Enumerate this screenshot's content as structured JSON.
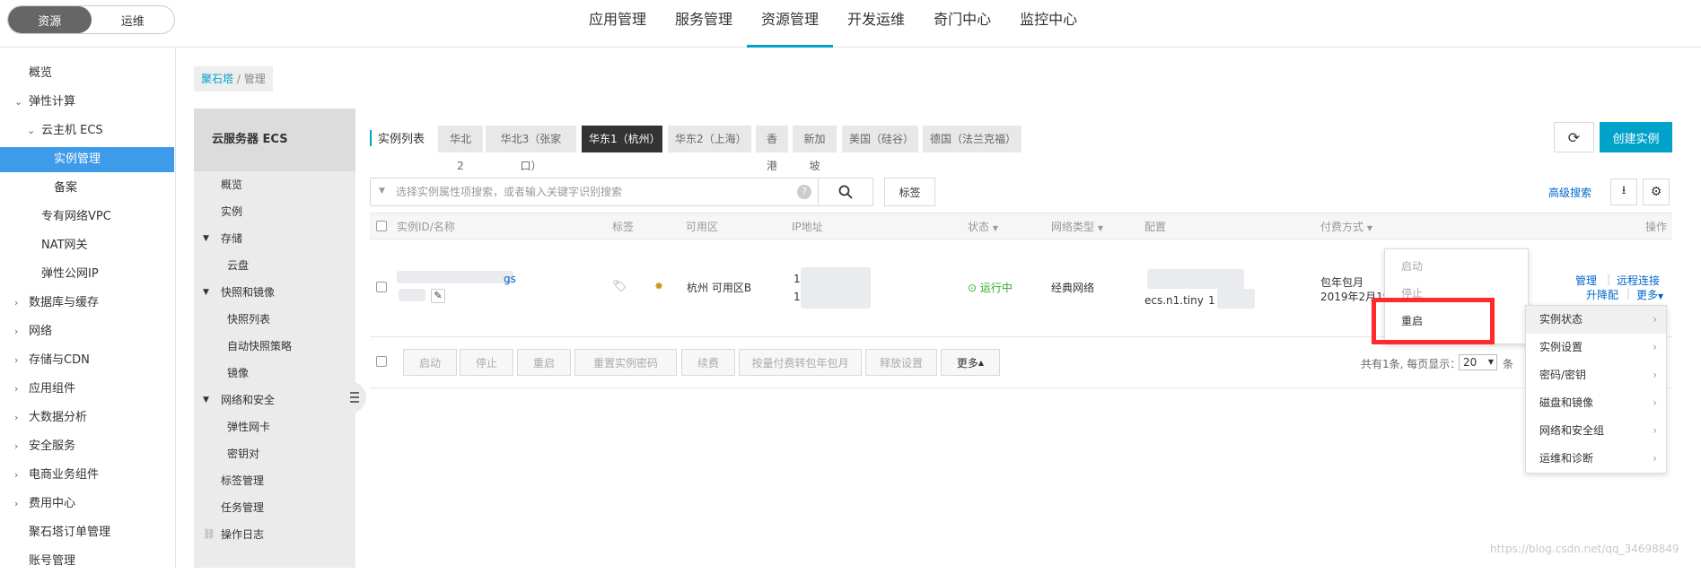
{
  "topbar": {
    "segments": [
      "资源",
      "运维"
    ],
    "nav": [
      "应用管理",
      "服务管理",
      "资源管理",
      "开发运维",
      "奇门中心",
      "监控中心"
    ]
  },
  "sidebar": {
    "items": [
      {
        "label": "概览"
      },
      {
        "label": "弹性计算",
        "chevron": "v"
      },
      {
        "label": "云主机 ECS",
        "chevron": "v"
      },
      {
        "label": "实例管理"
      },
      {
        "label": "备案"
      },
      {
        "label": "专有网络VPC"
      },
      {
        "label": "NAT网关"
      },
      {
        "label": "弹性公网IP"
      },
      {
        "label": "数据库与缓存",
        "chevron": ">"
      },
      {
        "label": "网络",
        "chevron": ">"
      },
      {
        "label": "存储与CDN",
        "chevron": ">"
      },
      {
        "label": "应用组件",
        "chevron": ">"
      },
      {
        "label": "大数据分析",
        "chevron": ">"
      },
      {
        "label": "安全服务",
        "chevron": ">"
      },
      {
        "label": "电商业务组件",
        "chevron": ">"
      },
      {
        "label": "费用中心",
        "chevron": ">"
      },
      {
        "label": "聚石塔订单管理"
      },
      {
        "label": "账号管理"
      }
    ]
  },
  "breadcrumb": {
    "link": "聚石塔",
    "sep": "/",
    "current": "管理"
  },
  "subsidebar": {
    "title": "云服务器 ECS",
    "items": [
      "概览",
      "实例",
      "存储",
      "云盘",
      "快照和镜像",
      "快照列表",
      "自动快照策略",
      "镜像",
      "网络和安全",
      "弹性网卡",
      "密钥对",
      "标签管理",
      "任务管理",
      "操作日志"
    ]
  },
  "regions": {
    "title": "实例列表",
    "tabs": [
      "华北 2",
      "华北3（张家口）",
      "华东1（杭州）",
      "华东2（上海）",
      "香港",
      "新加坡",
      "美国（硅谷）",
      "德国（法兰克福）"
    ]
  },
  "toolbar": {
    "create": "创建实例",
    "advanced": "高级搜索",
    "tag": "标签"
  },
  "search": {
    "placeholder": "选择实例属性项搜索，或者输入关键字识别搜索"
  },
  "table": {
    "headers": [
      "实例ID/名称",
      "标签",
      "可用区",
      "IP地址",
      "状态",
      "网络类型",
      "配置",
      "付费方式",
      "操作"
    ],
    "row": {
      "name_suffix": "gs",
      "zone": "杭州 可用区B",
      "ip1": "1",
      "ip2": "10",
      "status": "运行中",
      "network": "经典网络",
      "config": "ecs.n1.tiny",
      "config2": "1",
      "pay1": "包年包月",
      "pay2": "2019年2月19",
      "ops": {
        "manage": "管理",
        "remote": "远程连接",
        "upgrade": "升降配",
        "more": "更多"
      }
    }
  },
  "footer": {
    "buttons": [
      "启动",
      "停止",
      "重启",
      "重置实例密码",
      "续费",
      "按量付费转包年包月",
      "释放设置",
      "更多"
    ],
    "total": "共有1条, 每页显示：",
    "page_size": "20",
    "unit": "条"
  },
  "menu1": [
    "启动",
    "停止",
    "重启"
  ],
  "menu2": [
    "实例状态",
    "实例设置",
    "密码/密钥",
    "磁盘和镜像",
    "网络和安全组",
    "运维和诊断"
  ],
  "watermark": "https://blog.csdn.net/qq_34698849",
  "colors": {
    "accent": "#00a2ca",
    "active": "#3d9be9",
    "running": "#2fa82f",
    "highlight": "#ff2a2a"
  }
}
